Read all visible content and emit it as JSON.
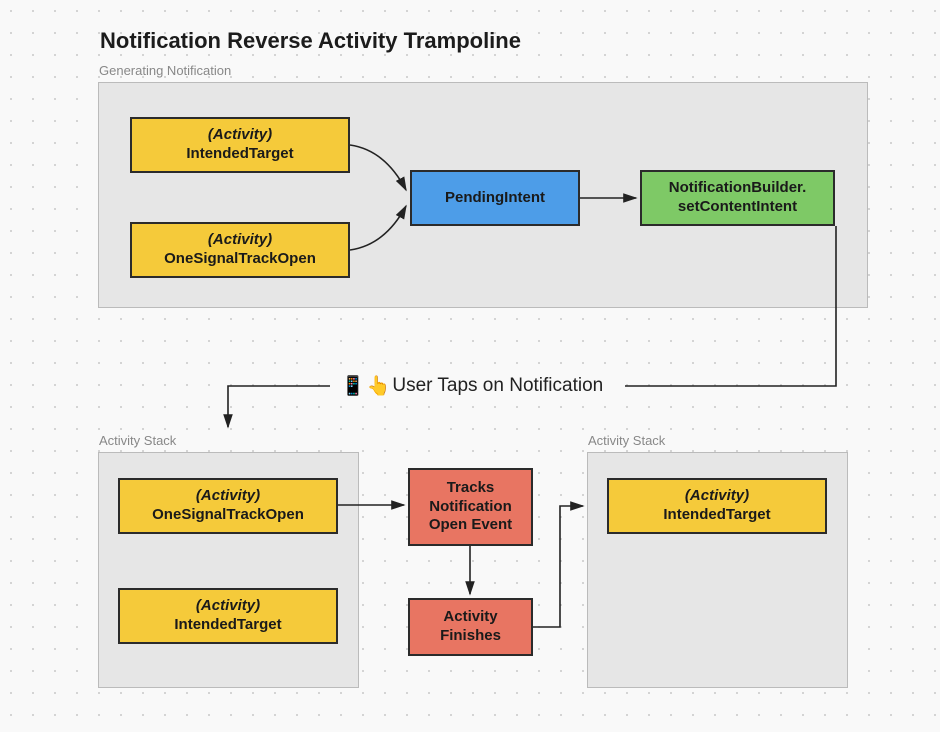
{
  "title": "Notification Reverse Activity Trampoline",
  "frames": {
    "gen": {
      "label": "Generating Notification"
    },
    "stack1": {
      "label": "Activity Stack"
    },
    "stack2": {
      "label": "Activity Stack"
    }
  },
  "nodes": {
    "intendedTarget1": {
      "subtitle": "(Activity)",
      "label": "IntendedTarget"
    },
    "oneSignal1": {
      "subtitle": "(Activity)",
      "label": "OneSignalTrackOpen"
    },
    "pendingIntent": {
      "label": "PendingIntent"
    },
    "builder": {
      "label1": "NotificationBuilder.",
      "label2": "setContentIntent"
    },
    "oneSignal2": {
      "subtitle": "(Activity)",
      "label": "OneSignalTrackOpen"
    },
    "intendedTarget2": {
      "subtitle": "(Activity)",
      "label": "IntendedTarget"
    },
    "tracks": {
      "line1": "Tracks",
      "line2": "Notification",
      "line3": "Open Event"
    },
    "finishes": {
      "line1": "Activity",
      "line2": "Finishes"
    },
    "intendedTarget3": {
      "subtitle": "(Activity)",
      "label": "IntendedTarget"
    }
  },
  "tapLabel": {
    "icon1": "📱",
    "icon2": "👆",
    "text": "User Taps on Notification"
  }
}
